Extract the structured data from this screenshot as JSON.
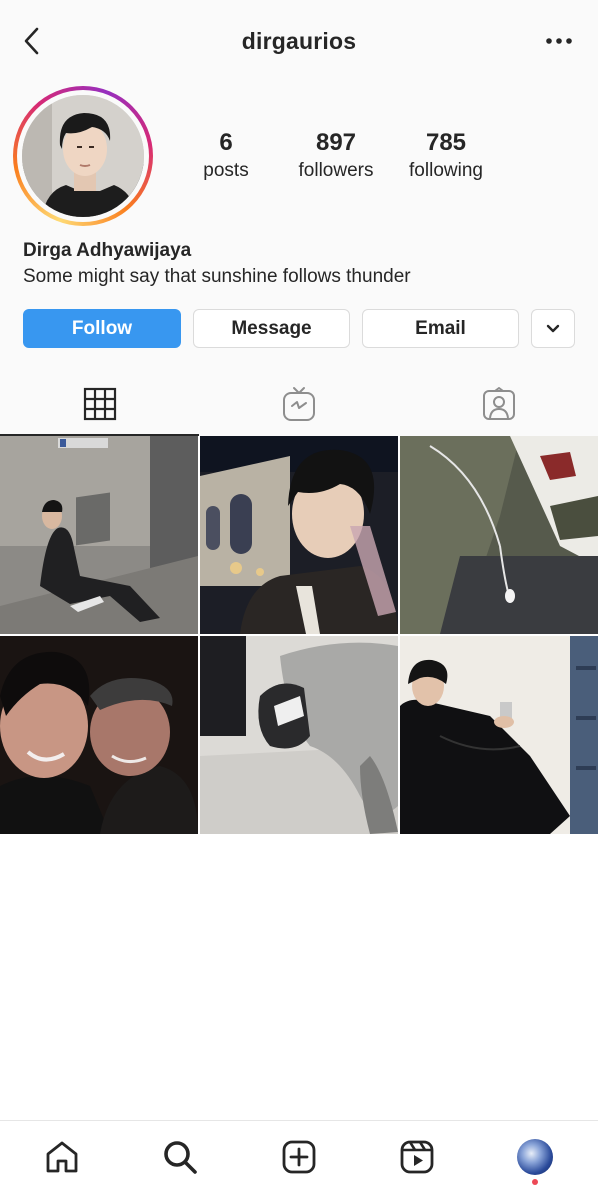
{
  "header": {
    "username": "dirgaurios",
    "back_icon": "chevron-left-icon",
    "more_icon": "more-horizontal-icon"
  },
  "profile": {
    "stats": [
      {
        "value": "6",
        "label": "posts"
      },
      {
        "value": "897",
        "label": "followers"
      },
      {
        "value": "785",
        "label": "following"
      }
    ],
    "full_name": "Dirga Adhyawijaya",
    "bio": "Some might say that sunshine follows thunder"
  },
  "actions": {
    "follow_label": "Follow",
    "message_label": "Message",
    "email_label": "Email",
    "more_icon": "chevron-down-icon"
  },
  "tabs": [
    {
      "icon": "grid-icon",
      "active": true
    },
    {
      "icon": "igtv-icon",
      "active": false
    },
    {
      "icon": "tagged-icon",
      "active": false
    }
  ],
  "posts": [
    {
      "description": "man in black sitting against wall"
    },
    {
      "description": "selfie with drink at night street"
    },
    {
      "description": "green jacket with earphones"
    },
    {
      "description": "two friends smiling close up"
    },
    {
      "description": "grey jeans and cap on floor"
    },
    {
      "description": "man in black leather sitting with phone"
    }
  ],
  "bottom_nav": [
    {
      "icon": "home-icon"
    },
    {
      "icon": "search-icon"
    },
    {
      "icon": "new-post-icon"
    },
    {
      "icon": "reels-icon"
    },
    {
      "icon": "profile-avatar"
    }
  ],
  "colors": {
    "follow_button": "#3897f0",
    "text": "#262626",
    "notification_dot": "#ed4956"
  }
}
